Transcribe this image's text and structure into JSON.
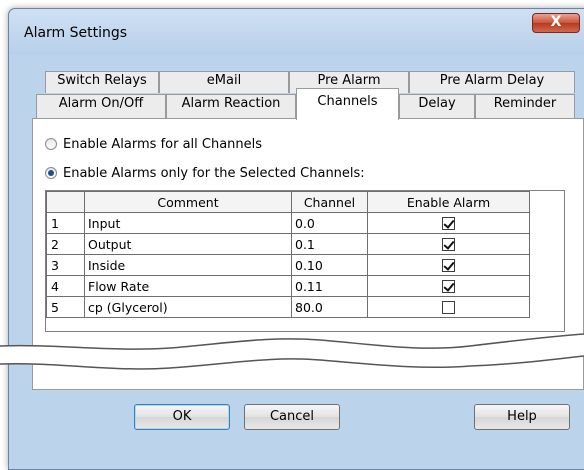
{
  "window": {
    "title": "Alarm Settings",
    "close_glyph": "X"
  },
  "tabs_back": [
    "Switch Relays",
    "eMail",
    "Pre Alarm",
    "Pre Alarm Delay"
  ],
  "tabs_front": [
    "Alarm On/Off",
    "Alarm Reaction",
    "Channels",
    "Delay",
    "Reminder"
  ],
  "active_tab": "Channels",
  "radios": {
    "all": "Enable Alarms for all Channels",
    "selected": "Enable Alarms only for the Selected Channels:",
    "checked": "selected"
  },
  "grid": {
    "headers": [
      "",
      "Comment",
      "Channel",
      "Enable Alarm"
    ],
    "rows": [
      {
        "num": "1",
        "comment": "Input",
        "channel": "0.0",
        "enabled": true
      },
      {
        "num": "2",
        "comment": "Output",
        "channel": "0.1",
        "enabled": true
      },
      {
        "num": "3",
        "comment": "Inside",
        "channel": "0.10",
        "enabled": true
      },
      {
        "num": "4",
        "comment": "Flow Rate",
        "channel": "0.11",
        "enabled": true
      },
      {
        "num": "5",
        "comment": "cp (Glycerol)",
        "channel": "80.0",
        "enabled": false
      }
    ]
  },
  "buttons": {
    "ok": "OK",
    "cancel": "Cancel",
    "help": "Help"
  },
  "icons": {
    "close": "close-icon",
    "radio": "radio-icon",
    "checkbox": "checkbox-icon"
  },
  "colors": {
    "title_bg": "#bcd3ec",
    "close_btn": "#c9533a",
    "dialog_bg": "#f0f0f0"
  }
}
